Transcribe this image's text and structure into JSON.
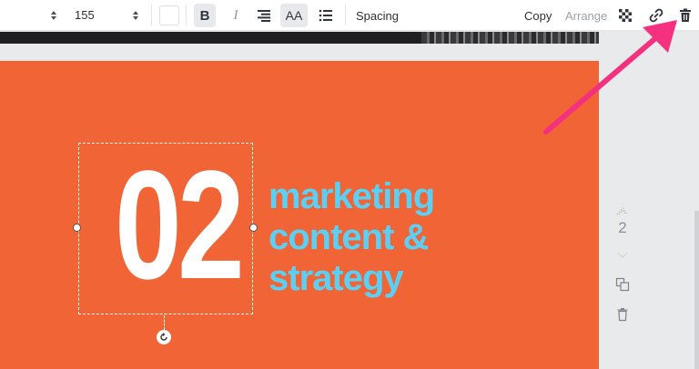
{
  "toolbar": {
    "font_size": "155",
    "bold_label": "B",
    "italic_label": "I",
    "case_label": "AA",
    "spacing_label": "Spacing",
    "copy_label": "Copy",
    "arrange_label": "Arrange"
  },
  "canvas": {
    "number": "02",
    "headline_line1": "marketing",
    "headline_line2": "content &",
    "headline_line3": "strategy"
  },
  "side_panel": {
    "page_number": "2"
  },
  "colors": {
    "slide_bg": "#f06435",
    "headline": "#5bd0f4",
    "number": "#ffffff",
    "arrow": "#f5317f"
  },
  "icons": [
    "stepper-icon",
    "align-right-icon",
    "list-icon",
    "transparency-icon",
    "link-icon",
    "trash-icon",
    "duplicate-icon",
    "rotate-icon"
  ]
}
